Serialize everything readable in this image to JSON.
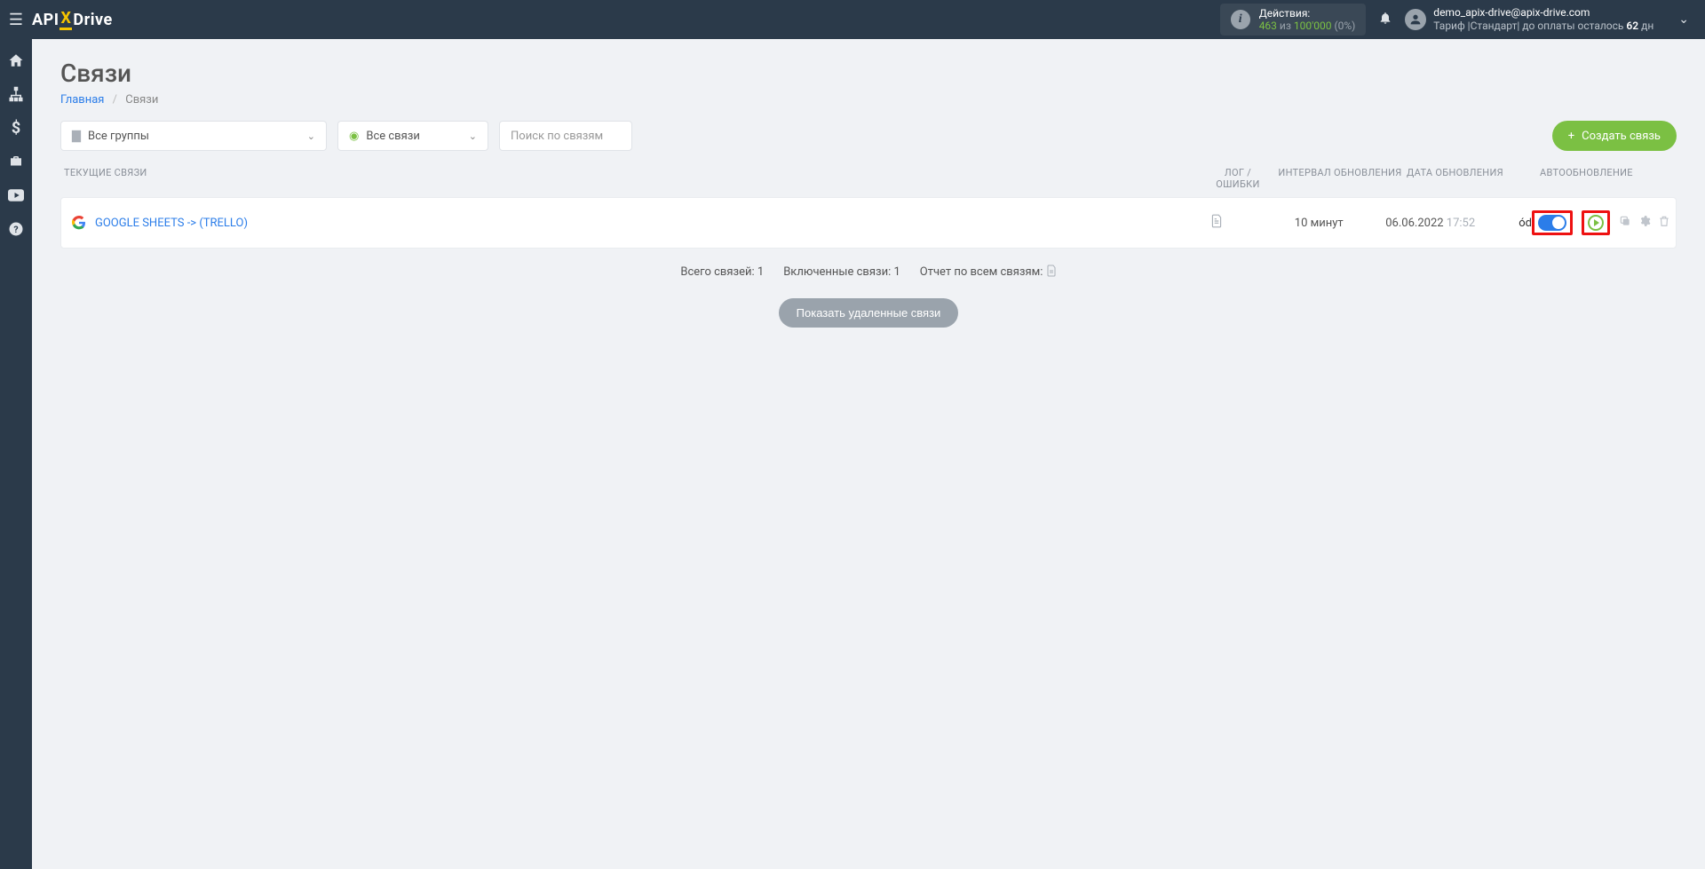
{
  "logo": {
    "pre": "API",
    "x": "X",
    "post": "Drive"
  },
  "header": {
    "actions_label": "Действия:",
    "actions_current": "463",
    "actions_sep": "из",
    "actions_total": "100'000",
    "actions_pct": "(0%)",
    "user_email": "demo_apix-drive@apix-drive.com",
    "tariff_prefix": "Тариф |Стандарт| до оплаты осталось ",
    "tariff_days": "62",
    "tariff_suffix": " дн"
  },
  "page": {
    "title": "Связи",
    "breadcrumb_home": "Главная",
    "breadcrumb_sep": "/",
    "breadcrumb_current": "Связи"
  },
  "filters": {
    "groups": "Все группы",
    "connections": "Все связи",
    "search_placeholder": "Поиск по связям",
    "create_btn": "Создать связь"
  },
  "columns": {
    "name": "ТЕКУЩИЕ СВЯЗИ",
    "log": "ЛОГ / ОШИБКИ",
    "interval": "ИНТЕРВАЛ ОБНОВЛЕНИЯ",
    "date": "ДАТА ОБНОВЛЕНИЯ",
    "auto": "АВТООБНОВЛЕНИЕ"
  },
  "rows": [
    {
      "name": "GOOGLE SHEETS -> (trello)",
      "interval": "10 минут",
      "date": "06.06.2022",
      "time": "17:52"
    }
  ],
  "summary": {
    "total": "Всего связей: 1",
    "enabled": "Включенные связи: 1",
    "report": "Отчет по всем связям:"
  },
  "show_deleted": "Показать удаленные связи"
}
